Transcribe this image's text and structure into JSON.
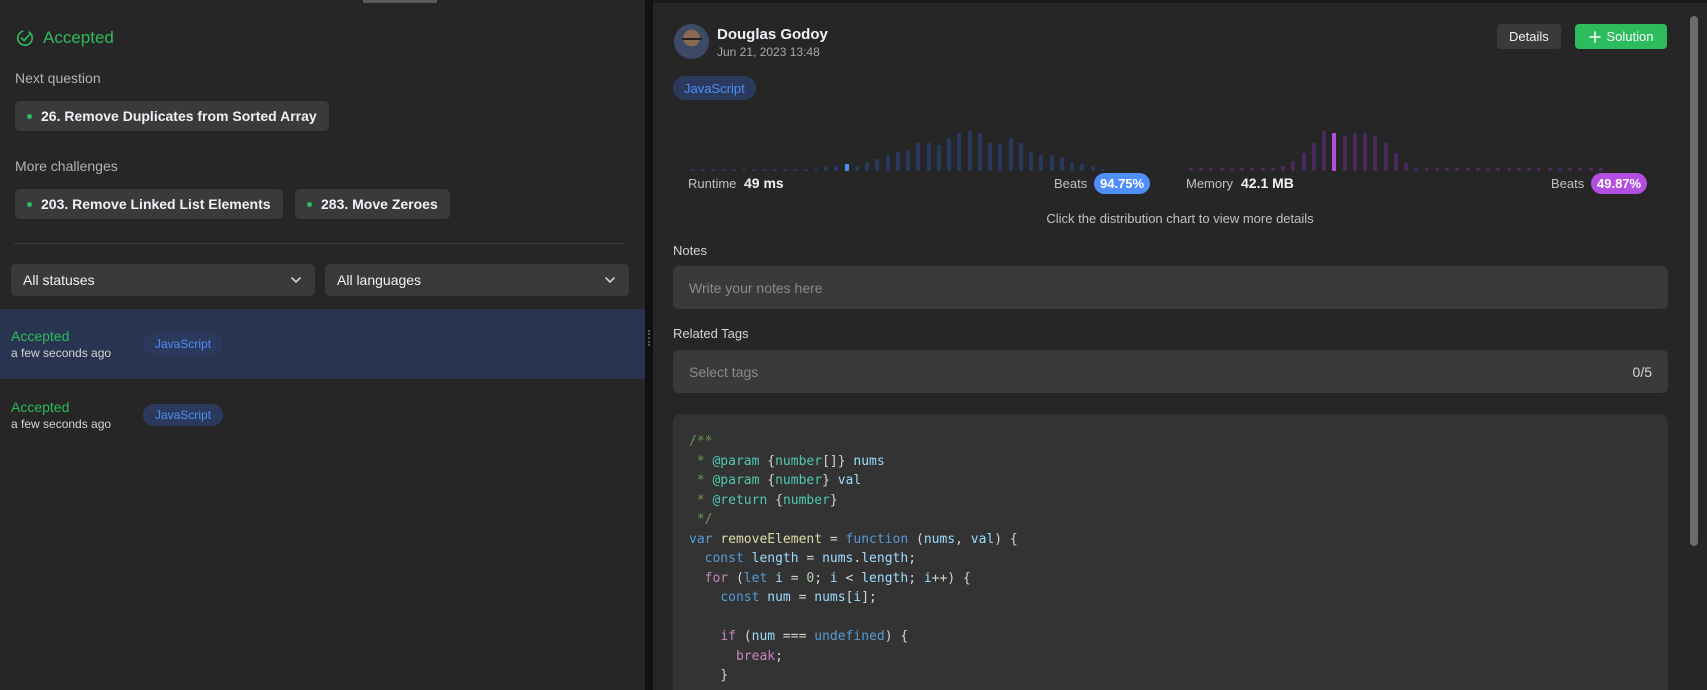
{
  "left": {
    "accepted_title": "Accepted",
    "next_question_label": "Next question",
    "next_question": "26. Remove Duplicates from Sorted Array",
    "more_challenges_label": "More challenges",
    "challenges": [
      "203. Remove Linked List Elements",
      "283. Move Zeroes"
    ],
    "status_filter": "All statuses",
    "language_filter": "All languages",
    "submissions": [
      {
        "status": "Accepted",
        "time": "a few seconds ago",
        "language": "JavaScript"
      },
      {
        "status": "Accepted",
        "time": "a few seconds ago",
        "language": "JavaScript"
      }
    ]
  },
  "right": {
    "user_name": "Douglas Godoy",
    "date": "Jun 21, 2023 13:48",
    "details_label": "Details",
    "solution_label": "Solution",
    "language": "JavaScript",
    "runtime_label": "Runtime",
    "runtime_value": "49 ms",
    "runtime_beats_label": "Beats",
    "runtime_beats": "94.75%",
    "memory_label": "Memory",
    "memory_value": "42.1 MB",
    "memory_beats_label": "Beats",
    "memory_beats": "49.87%",
    "hint": "Click the distribution chart to view more details",
    "notes_label": "Notes",
    "notes_placeholder": "Write your notes here",
    "tags_label": "Related Tags",
    "tags_placeholder": "Select tags",
    "tags_count": "0/5"
  },
  "colors": {
    "accent_green": "#2cbb5d",
    "runtime_blue": "#4f8ff7",
    "memory_purple": "#b24fe0"
  },
  "chart_data": [
    {
      "type": "bar",
      "name": "runtime-distribution",
      "values": [
        1,
        1,
        1,
        1,
        1,
        1,
        1,
        1,
        1,
        1,
        1,
        1,
        1,
        2,
        2,
        3,
        2,
        4,
        5,
        7,
        8,
        9,
        12,
        12,
        11,
        14,
        16,
        17,
        16,
        12,
        12,
        14,
        12,
        8,
        7,
        7,
        6,
        4,
        3,
        2,
        1
      ],
      "highlight_index": 15
    },
    {
      "type": "bar",
      "name": "memory-distribution",
      "values": [
        1,
        1,
        1,
        1,
        1,
        1,
        1,
        1,
        1,
        2,
        4,
        7,
        11,
        16,
        15,
        14,
        15,
        15,
        14,
        11,
        7,
        3,
        1,
        1,
        1,
        1,
        1,
        1,
        1,
        1,
        1,
        1,
        1,
        1,
        1,
        1,
        1,
        1,
        1,
        1,
        1
      ],
      "highlight_index": 14
    }
  ],
  "code_lines": [
    [
      [
        "c",
        "/**"
      ]
    ],
    [
      [
        "c",
        " * "
      ],
      [
        "k",
        "@param"
      ],
      [
        "p",
        " {"
      ],
      [
        "t",
        "number"
      ],
      [
        "p",
        "[]} "
      ],
      [
        "v",
        "nums"
      ]
    ],
    [
      [
        "c",
        " * "
      ],
      [
        "k",
        "@param"
      ],
      [
        "p",
        " {"
      ],
      [
        "t",
        "number"
      ],
      [
        "p",
        "} "
      ],
      [
        "v",
        "val"
      ]
    ],
    [
      [
        "c",
        " * "
      ],
      [
        "k",
        "@return"
      ],
      [
        "p",
        " {"
      ],
      [
        "t",
        "number"
      ],
      [
        "p",
        "}"
      ]
    ],
    [
      [
        "c",
        " */"
      ]
    ],
    [
      [
        "b",
        "var"
      ],
      [
        "p",
        " "
      ],
      [
        "f",
        "removeElement"
      ],
      [
        "p",
        " = "
      ],
      [
        "b",
        "function"
      ],
      [
        "p",
        " ("
      ],
      [
        "v",
        "nums"
      ],
      [
        "p",
        ", "
      ],
      [
        "v",
        "val"
      ],
      [
        "p",
        ") {"
      ]
    ],
    [
      [
        "p",
        "  "
      ],
      [
        "b",
        "const"
      ],
      [
        "p",
        " "
      ],
      [
        "v",
        "length"
      ],
      [
        "p",
        " = "
      ],
      [
        "v",
        "nums"
      ],
      [
        "p",
        "."
      ],
      [
        "v",
        "length"
      ],
      [
        "p",
        ";"
      ]
    ],
    [
      [
        "p",
        "  "
      ],
      [
        "m",
        "for"
      ],
      [
        "p",
        " ("
      ],
      [
        "b",
        "let"
      ],
      [
        "p",
        " "
      ],
      [
        "v",
        "i"
      ],
      [
        "p",
        " = "
      ],
      [
        "n",
        "0"
      ],
      [
        "p",
        "; "
      ],
      [
        "v",
        "i"
      ],
      [
        "p",
        " < "
      ],
      [
        "v",
        "length"
      ],
      [
        "p",
        "; "
      ],
      [
        "v",
        "i"
      ],
      [
        "p",
        "++) {"
      ]
    ],
    [
      [
        "p",
        "    "
      ],
      [
        "b",
        "const"
      ],
      [
        "p",
        " "
      ],
      [
        "v",
        "num"
      ],
      [
        "p",
        " = "
      ],
      [
        "v",
        "nums"
      ],
      [
        "p",
        "["
      ],
      [
        "v",
        "i"
      ],
      [
        "p",
        "];"
      ]
    ],
    [
      [
        "p",
        ""
      ]
    ],
    [
      [
        "p",
        "    "
      ],
      [
        "m",
        "if"
      ],
      [
        "p",
        " ("
      ],
      [
        "v",
        "num"
      ],
      [
        "p",
        " === "
      ],
      [
        "b",
        "undefined"
      ],
      [
        "p",
        ") {"
      ]
    ],
    [
      [
        "p",
        "      "
      ],
      [
        "m",
        "break"
      ],
      [
        "p",
        ";"
      ]
    ],
    [
      [
        "p",
        "    }"
      ]
    ]
  ]
}
